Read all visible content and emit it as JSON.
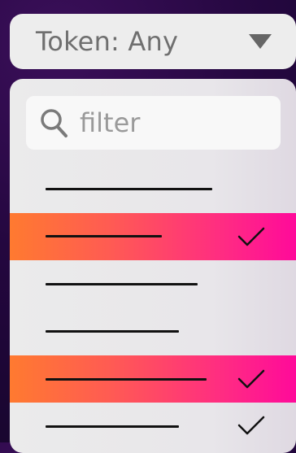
{
  "trigger": {
    "label": "Token: Any",
    "caret_icon": "triangle-down-icon"
  },
  "filter": {
    "placeholder": "filter",
    "value": "",
    "icon": "search-icon"
  },
  "options": [
    {
      "label": "",
      "selected": false
    },
    {
      "label": "",
      "selected": true
    },
    {
      "label": "",
      "selected": false
    },
    {
      "label": "",
      "selected": false
    },
    {
      "label": "",
      "selected": true
    },
    {
      "label": "",
      "selected": false
    }
  ],
  "colors": {
    "selected_gradient_start": "#ff7a30",
    "selected_gradient_end": "#ff0a9a",
    "background": "#24073f",
    "surface": "#ededed"
  }
}
